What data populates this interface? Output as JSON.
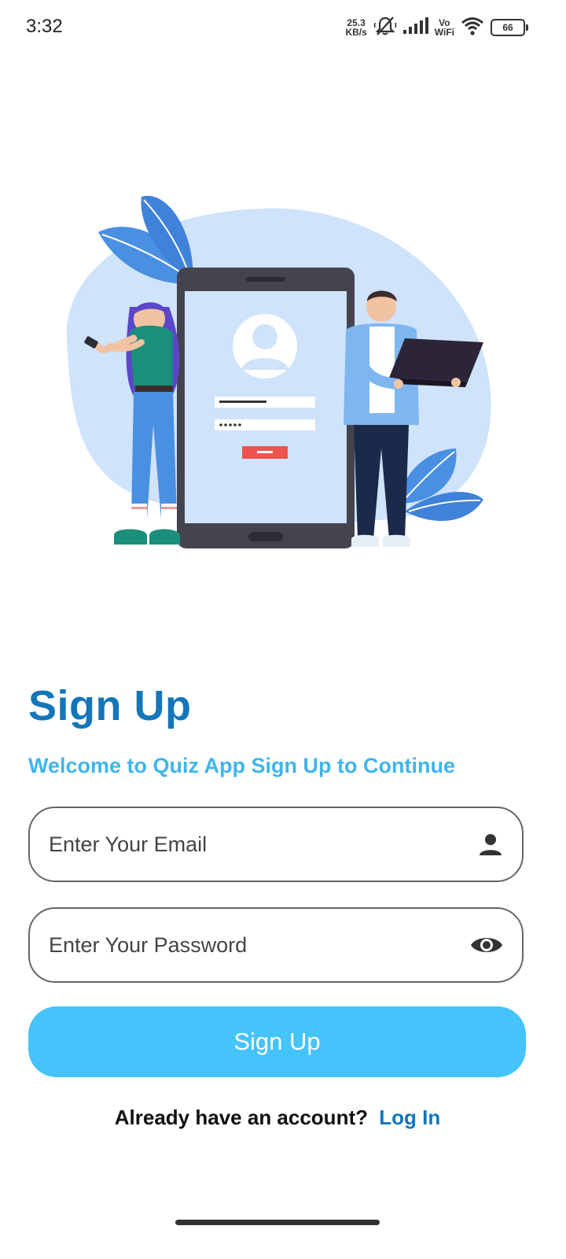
{
  "status_bar": {
    "time": "3:32",
    "speed_value": "25.3",
    "speed_unit": "KB/s",
    "vo_label": "Vo",
    "wifi_label": "WiFi",
    "battery_level": "66",
    "icons": [
      "mute-bell-icon",
      "signal-icon",
      "wifi-icon",
      "battery-icon"
    ]
  },
  "illustration": {
    "description_icon": "sign-up-illustration",
    "colors": {
      "blob": "#cfe3fb",
      "leaf": "#4a90e2",
      "phone_frame": "#44444f",
      "screen": "#cfe3fb",
      "login_button": "#ef5350"
    }
  },
  "header": {
    "title": "Sign Up",
    "subtitle": "Welcome to Quiz App Sign Up to Continue"
  },
  "form": {
    "email": {
      "placeholder": "Enter Your Email",
      "value": "",
      "icon": "person-icon"
    },
    "password": {
      "placeholder": "Enter Your Password",
      "value": "",
      "icon": "eye-icon"
    },
    "submit_label": "Sign Up"
  },
  "footer": {
    "prompt": "Already have an account?",
    "link": "Log In"
  },
  "colors": {
    "title": "#1376b9",
    "subtitle": "#40b5ea",
    "button": "#45c3fb",
    "link": "#1376b9"
  }
}
